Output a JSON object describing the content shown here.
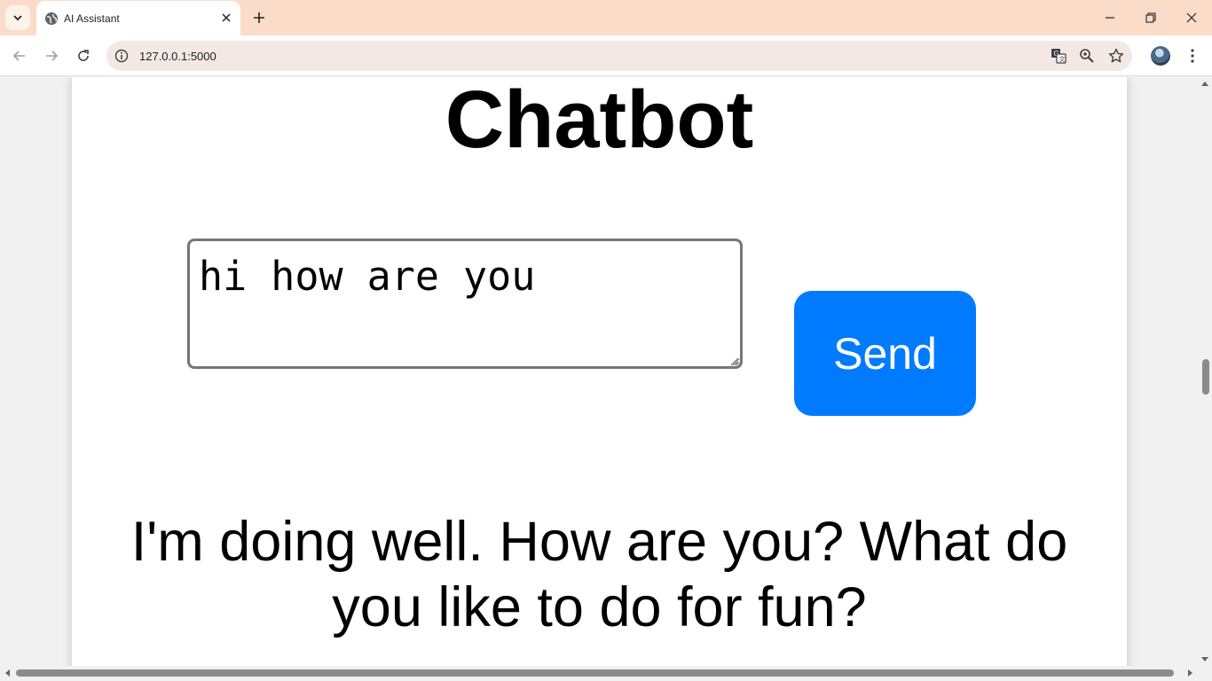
{
  "browser": {
    "tab": {
      "title": "AI Assistant",
      "favicon": "globe-icon"
    },
    "url": "127.0.0.1:5000",
    "icons": [
      "tab-search-icon",
      "close-icon",
      "new-tab-icon",
      "minimize-icon",
      "restore-icon",
      "window-close-icon",
      "back-icon",
      "forward-icon",
      "reload-icon",
      "site-info-icon",
      "translate-icon",
      "zoom-icon",
      "bookmark-star-icon",
      "profile-avatar",
      "menu-dots-icon"
    ]
  },
  "page": {
    "title": "Chatbot",
    "input": {
      "value": "hi how are you"
    },
    "send_label": "Send",
    "response": "I'm doing well. How are you? What do you like to do for fun?"
  },
  "colors": {
    "tabstrip": "#fbdcc8",
    "send_button": "#007bff",
    "page_background": "#f1f1f1",
    "card_background": "#ffffff"
  }
}
